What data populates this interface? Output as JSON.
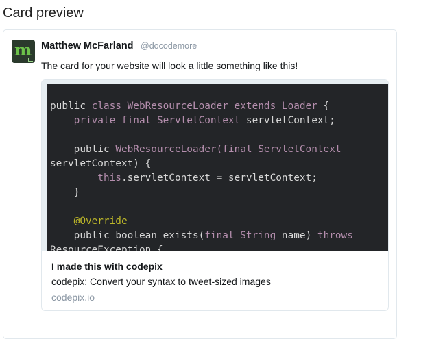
{
  "page": {
    "title": "Card preview"
  },
  "tweet": {
    "author_name": "Matthew McFarland",
    "author_handle": "@docodemore",
    "avatar_letter": "m",
    "text": "The card for your website will look a little something like this!"
  },
  "card": {
    "code_lines": [
      [
        {
          "t": "public ",
          "c": "kw"
        },
        {
          "t": "class ",
          "c": "cls"
        },
        {
          "t": "WebResourceLoader ",
          "c": "cls"
        },
        {
          "t": "extends ",
          "c": "cls"
        },
        {
          "t": "Loader ",
          "c": "cls"
        },
        {
          "t": "{",
          "c": "plain"
        }
      ],
      [
        {
          "t": "    private ",
          "c": "cls"
        },
        {
          "t": "final ",
          "c": "cls"
        },
        {
          "t": "ServletContext ",
          "c": "cls"
        },
        {
          "t": "servletContext;",
          "c": "plain"
        }
      ],
      [],
      [
        {
          "t": "    public ",
          "c": "kw"
        },
        {
          "t": "WebResourceLoader(",
          "c": "cls"
        },
        {
          "t": "final ",
          "c": "cls"
        },
        {
          "t": "ServletContext",
          "c": "cls"
        }
      ],
      [
        {
          "t": "servletContext) {",
          "c": "plain"
        }
      ],
      [
        {
          "t": "        this",
          "c": "cls"
        },
        {
          "t": ".servletContext = servletContext;",
          "c": "plain"
        }
      ],
      [
        {
          "t": "    }",
          "c": "plain"
        }
      ],
      [],
      [
        {
          "t": "    @Override",
          "c": "ann"
        }
      ],
      [
        {
          "t": "    public ",
          "c": "kw"
        },
        {
          "t": "boolean ",
          "c": "kw"
        },
        {
          "t": "exists(",
          "c": "plain"
        },
        {
          "t": "final ",
          "c": "cls"
        },
        {
          "t": "String ",
          "c": "cls"
        },
        {
          "t": "name) ",
          "c": "plain"
        },
        {
          "t": "throws",
          "c": "cls"
        }
      ],
      [
        {
          "t": "ResourceException {",
          "c": "plain"
        }
      ]
    ],
    "title": "I made this with codepix",
    "description": "codepix: Convert your syntax to tweet-sized images",
    "domain": "codepix.io"
  },
  "colors": {
    "code_background": "#232528",
    "code_frame": "#e7eef2",
    "keyword_purple": "#b48ead",
    "annotation_yellow": "#bbb529",
    "avatar_green": "#6cc24a",
    "handle_grey": "#8a96a3"
  }
}
